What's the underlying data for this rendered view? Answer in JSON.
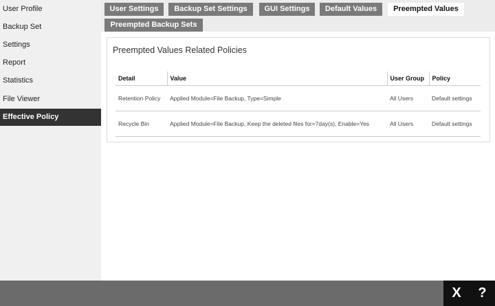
{
  "sidebar": {
    "items": [
      {
        "label": "User Profile"
      },
      {
        "label": "Backup Set"
      },
      {
        "label": "Settings"
      },
      {
        "label": "Report"
      },
      {
        "label": "Statistics"
      },
      {
        "label": "File Viewer"
      },
      {
        "label": "Effective Policy",
        "active": true
      }
    ]
  },
  "tabs": [
    {
      "label": "User Settings"
    },
    {
      "label": "Backup Set Settings"
    },
    {
      "label": "GUI Settings"
    },
    {
      "label": "Default Values"
    },
    {
      "label": "Preempted Values",
      "active": true
    },
    {
      "label": "Preempted Backup Sets"
    }
  ],
  "panel": {
    "title": "Preempted Values Related Policies",
    "columns": [
      "Detail",
      "Value",
      "User Group",
      "Policy"
    ],
    "rows": [
      {
        "detail": "Retention Policy",
        "value": "Applied Module=File Backup, Type=Simple",
        "user_group": "All Users",
        "policy": "Default settings"
      },
      {
        "detail": "Recycle Bin",
        "value": "Applied Module=File Backup, Keep the deleted files for=7day(s), Enable=Yes",
        "user_group": "All Users",
        "policy": "Default settings"
      }
    ]
  },
  "footer": {
    "close": "X",
    "help": "?"
  }
}
